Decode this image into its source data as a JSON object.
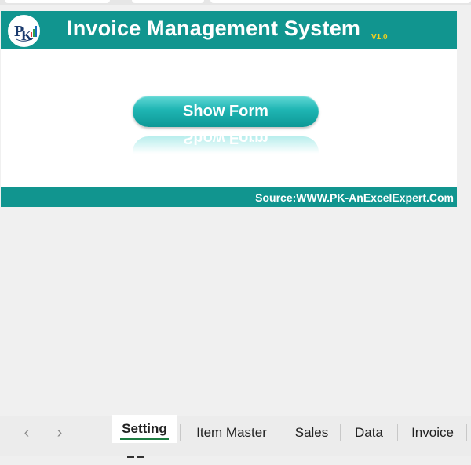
{
  "app": {
    "title": "Invoice Management System",
    "version": "V1.0",
    "logo_icon": "pk-logo-icon"
  },
  "main": {
    "show_form_button": "Show Form"
  },
  "footer": {
    "source": "Source:WWW.PK-AnExcelExpert.Com"
  },
  "sheet_tabs": {
    "prev_icon": "chevron-left-icon",
    "next_icon": "chevron-right-icon",
    "prev_glyph": "‹",
    "next_glyph": "›",
    "items": [
      {
        "label": "Setting",
        "active": true
      },
      {
        "label": "Item Master",
        "active": false
      },
      {
        "label": "Sales",
        "active": false
      },
      {
        "label": "Data",
        "active": false
      },
      {
        "label": "Invoice",
        "active": false
      }
    ]
  },
  "colors": {
    "banner": "#11958f",
    "button_top": "#62d9d6",
    "button_bottom": "#0d9896",
    "version": "#f6d21b",
    "active_tab_underline": "#1e7d43"
  }
}
